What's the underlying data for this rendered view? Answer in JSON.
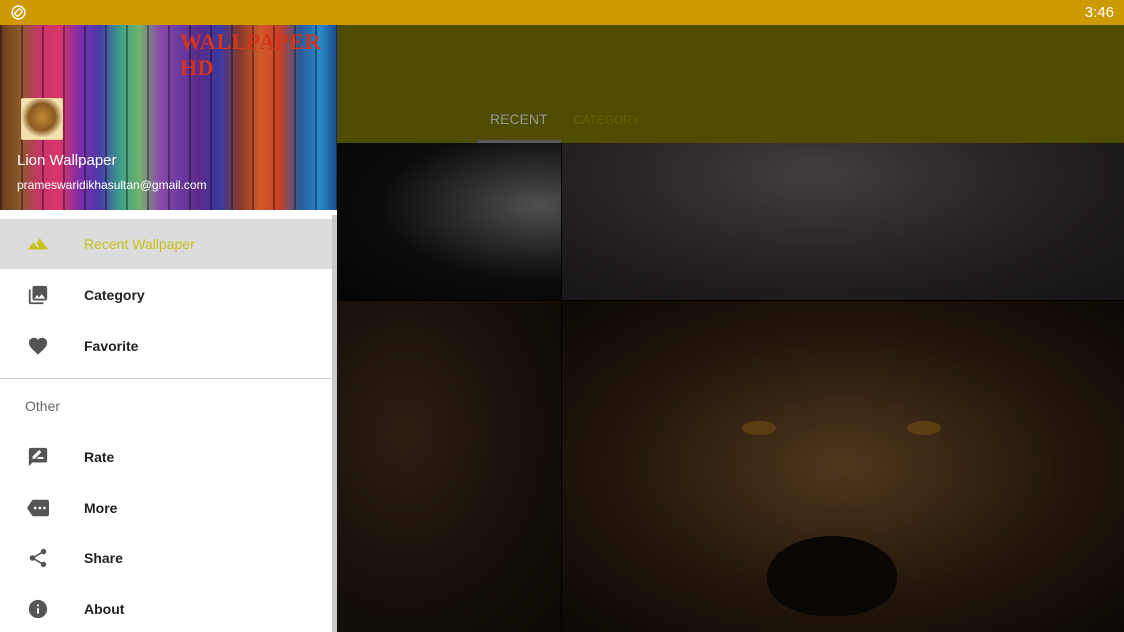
{
  "status_bar": {
    "time": "3:46",
    "left_icon": "screen-rotation-icon"
  },
  "toolbar": {
    "tabs": [
      {
        "label": "RECENT",
        "active": true
      },
      {
        "label": "CATEGORY",
        "active": false
      }
    ]
  },
  "drawer": {
    "header": {
      "brand": "WALLPAPER HD",
      "user_name": "Lion Wallpaper",
      "user_email": "prameswaridikhasultan@gmail.com"
    },
    "items": [
      {
        "label": "Recent Wallpaper",
        "icon": "landscape-icon",
        "selected": true
      },
      {
        "label": "Category",
        "icon": "photo-library-icon",
        "selected": false
      },
      {
        "label": "Favorite",
        "icon": "heart-icon",
        "selected": false
      }
    ],
    "other_header": "Other",
    "other_items": [
      {
        "label": "Rate",
        "icon": "rate-review-icon"
      },
      {
        "label": "More",
        "icon": "more-icon"
      },
      {
        "label": "Share",
        "icon": "share-icon"
      },
      {
        "label": "About",
        "icon": "info-icon"
      }
    ]
  },
  "colors": {
    "status_bar": "#cc9900",
    "selected_text": "#c7c21a",
    "icon": "#555555"
  }
}
